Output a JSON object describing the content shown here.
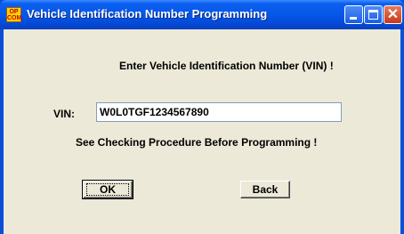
{
  "window": {
    "title": "Vehicle Identification Number Programming",
    "app_icon_text": "OP COM"
  },
  "form": {
    "instruction": "Enter Vehicle Identification Number (VIN) !",
    "vin_label": "VIN:",
    "vin_value": "W0L0TGF1234567890",
    "warning": "See Checking Procedure Before Programming !"
  },
  "buttons": {
    "ok_label": "OK",
    "back_label": "Back"
  },
  "colors": {
    "titlebar": "#0557e6",
    "client_background": "#ece9d8",
    "close_button": "#c7391a"
  },
  "icons": {
    "app": "opcom-app-icon",
    "minimize": "minimize-icon",
    "maximize": "maximize-icon",
    "close": "close-icon"
  }
}
